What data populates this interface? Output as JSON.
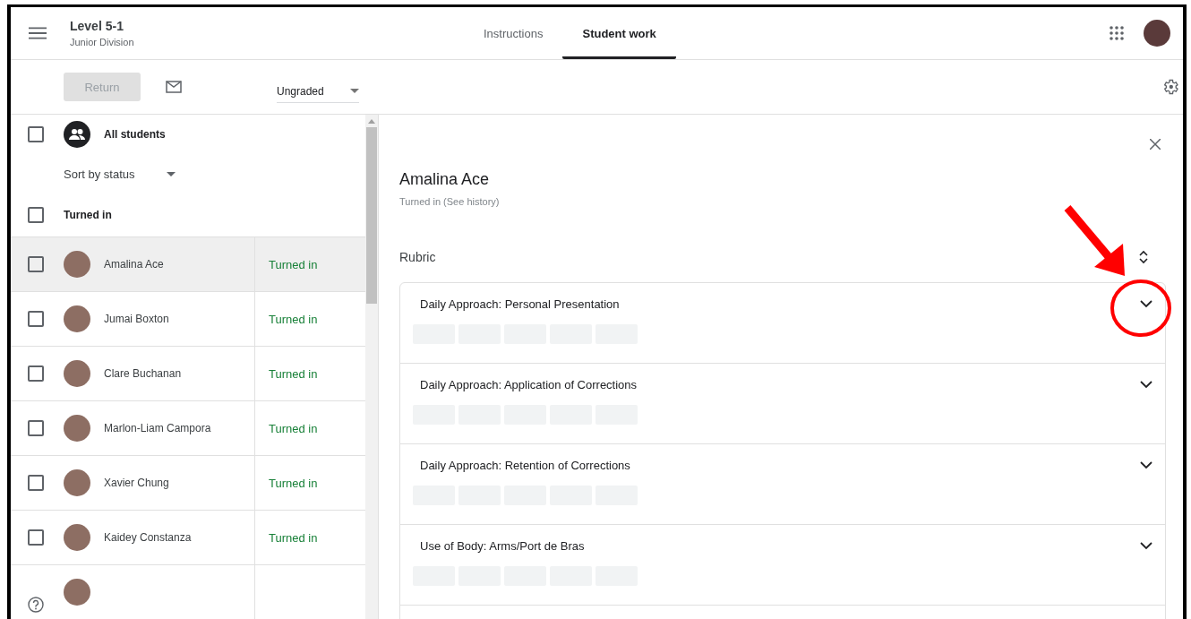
{
  "header": {
    "course_title": "Level 5-1",
    "course_subtitle": "Junior Division",
    "tabs": [
      {
        "label": "Instructions",
        "selected": false
      },
      {
        "label": "Student work",
        "selected": true
      }
    ]
  },
  "toolbar": {
    "return_button": {
      "label": "Return",
      "disabled": true
    },
    "grade_filter": {
      "value": "Ungraded"
    }
  },
  "student_list": {
    "all_students": {
      "label": "All students",
      "checked": false
    },
    "sort": {
      "label": "Sort by status"
    },
    "group": {
      "label": "Turned in",
      "checked": false
    },
    "students": [
      {
        "name": "Amalina Ace",
        "status": "Turned in",
        "selected": true,
        "checked": false
      },
      {
        "name": "Jumai Boxton",
        "status": "Turned in",
        "selected": false,
        "checked": false
      },
      {
        "name": "Clare Buchanan",
        "status": "Turned in",
        "selected": false,
        "checked": false
      },
      {
        "name": "Marlon-Liam Campora",
        "status": "Turned in",
        "selected": false,
        "checked": false
      },
      {
        "name": "Xavier Chung",
        "status": "Turned in",
        "selected": false,
        "checked": false
      },
      {
        "name": "Kaidey Constanza",
        "status": "Turned in",
        "selected": false,
        "checked": false
      }
    ]
  },
  "detail": {
    "student_name": "Amalina Ace",
    "status_text": "Turned in (See history)",
    "rubric_title": "Rubric",
    "criteria": [
      {
        "title": "Daily Approach: Personal Presentation",
        "expanded": false
      },
      {
        "title": "Daily Approach: Application of Corrections",
        "expanded": false
      },
      {
        "title": "Daily Approach: Retention of Corrections",
        "expanded": false
      },
      {
        "title": "Use of Body: Arms/Port de Bras",
        "expanded": false
      }
    ]
  }
}
